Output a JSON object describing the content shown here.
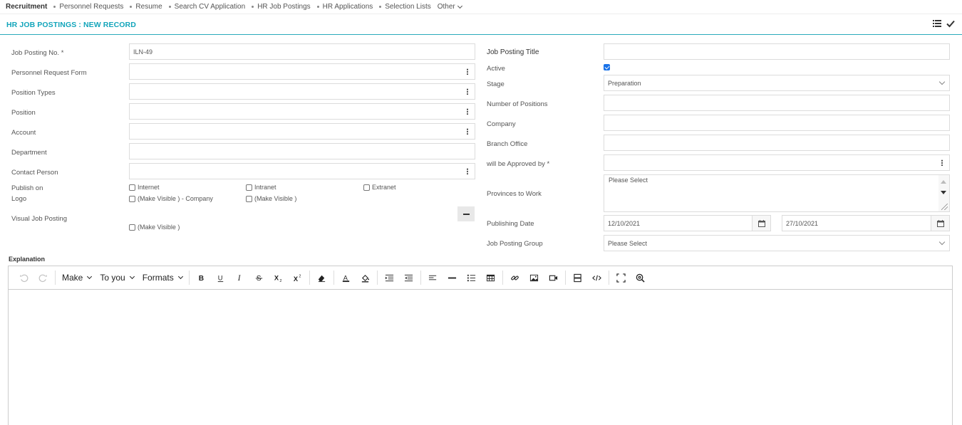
{
  "nav": {
    "items": [
      "Recruitment",
      "Personnel Requests",
      "Resume",
      "Search CV Application",
      "HR Job Postings",
      "HR Applications",
      "Selection Lists",
      "Other"
    ]
  },
  "header": {
    "title": "HR JOB POSTINGS : NEW RECORD"
  },
  "left": {
    "job_posting_no": {
      "label": "Job Posting No. *",
      "value": "ILN-49"
    },
    "personnel_request_form": {
      "label": "Personnel Request Form",
      "value": ""
    },
    "position_types": {
      "label": "Position Types",
      "value": ""
    },
    "position": {
      "label": "Position",
      "value": ""
    },
    "account": {
      "label": "Account",
      "value": ""
    },
    "department": {
      "label": "Department",
      "value": ""
    },
    "contact_person": {
      "label": "Contact Person",
      "value": ""
    },
    "publish_on": {
      "label": "Publish on",
      "options": [
        "Internet",
        "Intranet",
        "Extranet"
      ]
    },
    "logo": {
      "label": "Logo",
      "options": [
        "(Make Visible ) - Company",
        "(Make Visible )"
      ]
    },
    "visual_job_posting": {
      "label": "Visual Job Posting",
      "option": "(Make Visible )"
    }
  },
  "right": {
    "job_posting_title": {
      "label": "Job Posting Title",
      "value": ""
    },
    "active": {
      "label": "Active",
      "checked": true
    },
    "stage": {
      "label": "Stage",
      "value": "Preparation"
    },
    "number_of_positions": {
      "label": "Number of Positions",
      "value": ""
    },
    "company": {
      "label": "Company",
      "value": ""
    },
    "branch_office": {
      "label": "Branch Office",
      "value": ""
    },
    "approved_by": {
      "label": "will be Approved by *",
      "value": ""
    },
    "provinces": {
      "label": "Provinces to Work",
      "value": "Please Select"
    },
    "publishing_date": {
      "label": "Publishing Date",
      "start": "12/10/2021",
      "end": "27/10/2021"
    },
    "job_posting_group": {
      "label": "Job Posting Group",
      "value": "Please Select"
    }
  },
  "explanation": {
    "label": "Explanation"
  },
  "editor": {
    "menus": [
      "Make",
      "To you",
      "Formats"
    ]
  },
  "colors": {
    "accent": "#13a5bb",
    "checkbox": "#1a73e8"
  }
}
